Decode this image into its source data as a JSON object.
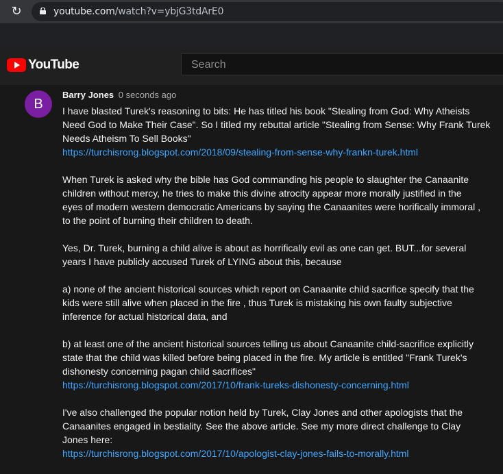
{
  "browser": {
    "url_host": "youtube.com",
    "url_path": "/watch?v=ybjG3tdArE0"
  },
  "header": {
    "logo_text": "YouTube",
    "search_placeholder": "Search"
  },
  "comment": {
    "avatar_letter": "B",
    "author": "Barry Jones",
    "timestamp": "0 seconds ago",
    "paragraphs": [
      {
        "lines": [
          "I have blasted Turek's reasoning to bits:  He has titled his book \"Stealing from God: Why Atheists",
          "Need God to Make Their Case\".  So I titled my rebuttal article \"Stealing from Sense: Why Frank Turek",
          "Needs Atheism To Sell Books\""
        ],
        "link": "https://turchisrong.blogspot.com/2018/09/stealing-from-sense-why-frankn-turek.html"
      },
      {
        "lines": [
          "When Turek is asked why the bible has God commanding his people to slaughter the Canaanite",
          "children without mercy, he tries to make this divine atrocity appear more morally justified in the",
          "eyes of modern western democratic Americans by saying the Canaanites were horifically immoral ,",
          "to the point of burning their children to death."
        ]
      },
      {
        "lines": [
          "Yes, Dr. Turek, burning a child alive is about as horrifically evil as one can get.  BUT...for several",
          "years I have publicly accused Turek of LYING about this, because"
        ]
      },
      {
        "lines": [
          "a) none of the ancient historical sources which report on Canaanite child sacrifice specify that the",
          "kids were still alive when placed in the fire , thus Turek is mistaking his own faulty subjective",
          "inference for actual historical data, and"
        ]
      },
      {
        "lines": [
          "b) at least one of the ancient historical sources telling us about Canaanite child-sacrifice explicitly",
          "state that the child was killed before being placed in the fire.  My article is entitled \"Frank Turek's",
          "dishonesty concerning pagan child sacrifices\""
        ],
        "link": "https://turchisrong.blogspot.com/2017/10/frank-tureks-dishonesty-concerning.html"
      },
      {
        "lines": [
          "I've also challenged the popular notion held by Turek, Clay Jones and other apologists that the",
          "Canaanites engaged in bestiality.  See the above article.  See my more direct challenge to Clay",
          "Jones here:"
        ],
        "link": "https://turchisrong.blogspot.com/2017/10/apologist-clay-jones-fails-to-morally.html"
      }
    ]
  }
}
